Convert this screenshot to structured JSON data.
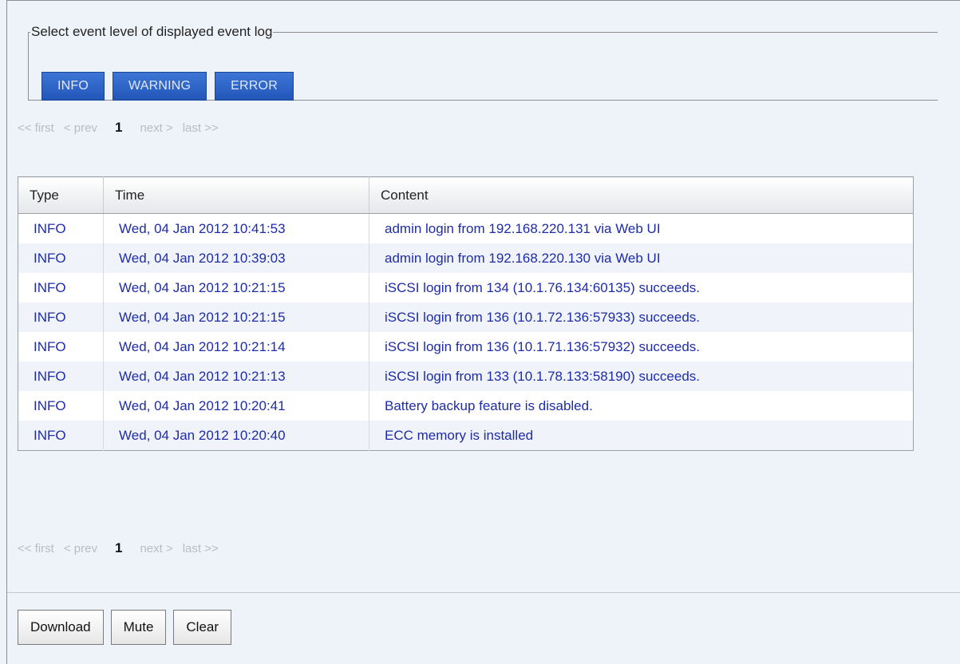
{
  "level_filter": {
    "legend": "Select event level of displayed event log",
    "buttons": [
      "INFO",
      "WARNING",
      "ERROR"
    ]
  },
  "pager": {
    "first": "<< first",
    "prev": "< prev",
    "current": "1",
    "next": "next >",
    "last": "last >>"
  },
  "table": {
    "headers": [
      "Type",
      "Time",
      "Content"
    ],
    "rows": [
      {
        "type": "INFO",
        "time": "Wed, 04 Jan 2012 10:41:53",
        "content": "admin login from 192.168.220.131 via Web UI"
      },
      {
        "type": "INFO",
        "time": "Wed, 04 Jan 2012 10:39:03",
        "content": "admin login from 192.168.220.130 via Web UI"
      },
      {
        "type": "INFO",
        "time": "Wed, 04 Jan 2012 10:21:15",
        "content": "iSCSI login from 134 (10.1.76.134:60135) succeeds."
      },
      {
        "type": "INFO",
        "time": "Wed, 04 Jan 2012 10:21:15",
        "content": "iSCSI login from 136 (10.1.72.136:57933) succeeds."
      },
      {
        "type": "INFO",
        "time": "Wed, 04 Jan 2012 10:21:14",
        "content": "iSCSI login from 136 (10.1.71.136:57932) succeeds."
      },
      {
        "type": "INFO",
        "time": "Wed, 04 Jan 2012 10:21:13",
        "content": "iSCSI login from 133 (10.1.78.133:58190) succeeds."
      },
      {
        "type": "INFO",
        "time": "Wed, 04 Jan 2012 10:20:41",
        "content": "Battery backup feature is disabled."
      },
      {
        "type": "INFO",
        "time": "Wed, 04 Jan 2012 10:20:40",
        "content": "ECC memory is installed"
      }
    ]
  },
  "actions": {
    "download": "Download",
    "mute": "Mute",
    "clear": "Clear"
  },
  "colors": {
    "level_button_bg": "#2f66c8",
    "log_text": "#1e2ca8",
    "page_bg": "#eef3f9"
  }
}
